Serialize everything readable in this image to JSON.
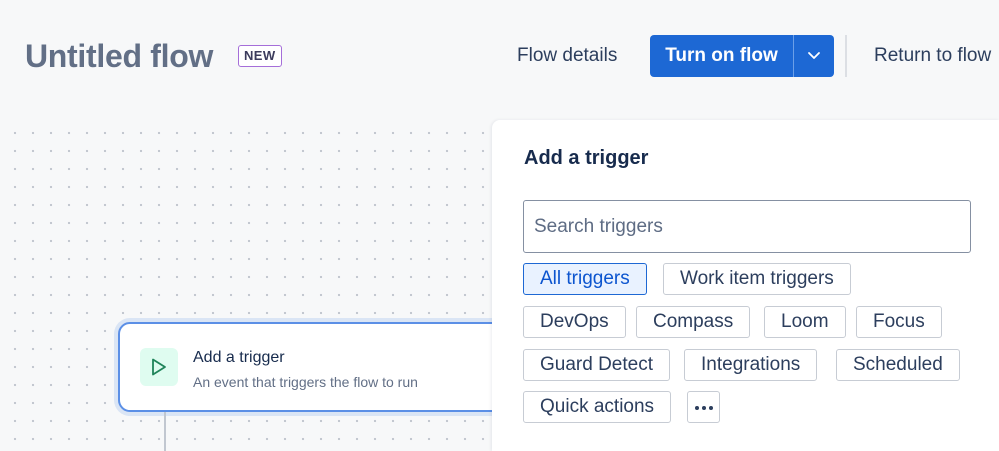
{
  "header": {
    "title": "Untitled flow",
    "badge": "NEW",
    "flow_details_label": "Flow details",
    "turn_on_label": "Turn on flow",
    "return_label": "Return to flow",
    "accent_color": "#1d68d4"
  },
  "canvas": {
    "trigger_node": {
      "title": "Add a trigger",
      "subtitle": "An event that triggers the flow to run",
      "icon": "play-icon"
    }
  },
  "panel": {
    "title": "Add a trigger",
    "search": {
      "placeholder": "Search triggers",
      "value": ""
    },
    "filters": [
      {
        "label": "All triggers",
        "selected": true
      },
      {
        "label": "Work item triggers",
        "selected": false
      },
      {
        "label": "DevOps",
        "selected": false
      },
      {
        "label": "Compass",
        "selected": false
      },
      {
        "label": "Loom",
        "selected": false
      },
      {
        "label": "Focus",
        "selected": false
      },
      {
        "label": "Guard Detect",
        "selected": false
      },
      {
        "label": "Integrations",
        "selected": false
      },
      {
        "label": "Scheduled",
        "selected": false
      },
      {
        "label": "Quick actions",
        "selected": false
      }
    ],
    "more_icon": "more-horizontal-icon"
  }
}
